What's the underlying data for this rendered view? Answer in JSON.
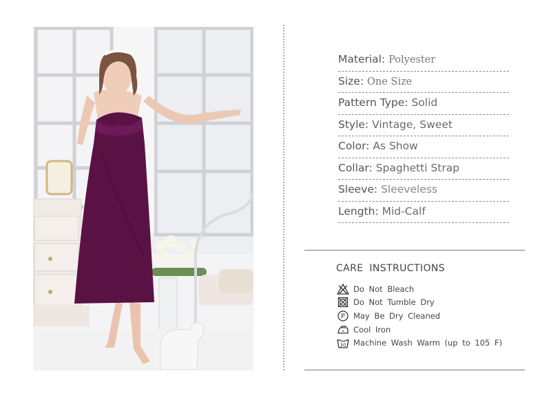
{
  "specs": [
    {
      "label": "Material:",
      "value": "Polyester",
      "serif": true
    },
    {
      "label": "Size:",
      "value": "One Size",
      "serif": true
    },
    {
      "label": "Pattern Type:",
      "value": "Solid",
      "serif": false
    },
    {
      "label": "Style:",
      "value": "Vintage, Sweet",
      "serif": false
    },
    {
      "label": "Color:",
      "value": "As Show",
      "serif": false
    },
    {
      "label": "Collar:",
      "value": "Spaghetti Strap",
      "serif": false
    },
    {
      "label": "Sleeve:",
      "value": "Sleeveless",
      "serif": false
    },
    {
      "label": "Length:",
      "value": "Mid-Calf",
      "serif": false
    }
  ],
  "care": {
    "title": "CARE  INSTRUCTIONS",
    "items": [
      {
        "icon": "no-bleach-icon",
        "text": "Do Not Bleach"
      },
      {
        "icon": "no-tumble-dry-icon",
        "text": "Do Not Tumble Dry"
      },
      {
        "icon": "dry-clean-p-icon",
        "text": "May Be Dry Cleaned"
      },
      {
        "icon": "cool-iron-icon",
        "text": "Cool Iron"
      },
      {
        "icon": "machine-wash-30-icon",
        "text": "Machine Wash Warm (up to 105 F)",
        "icon_text": "30"
      }
    ]
  },
  "colors": {
    "dress": "#5a1245",
    "text": "#555555",
    "divider": "#888888"
  }
}
